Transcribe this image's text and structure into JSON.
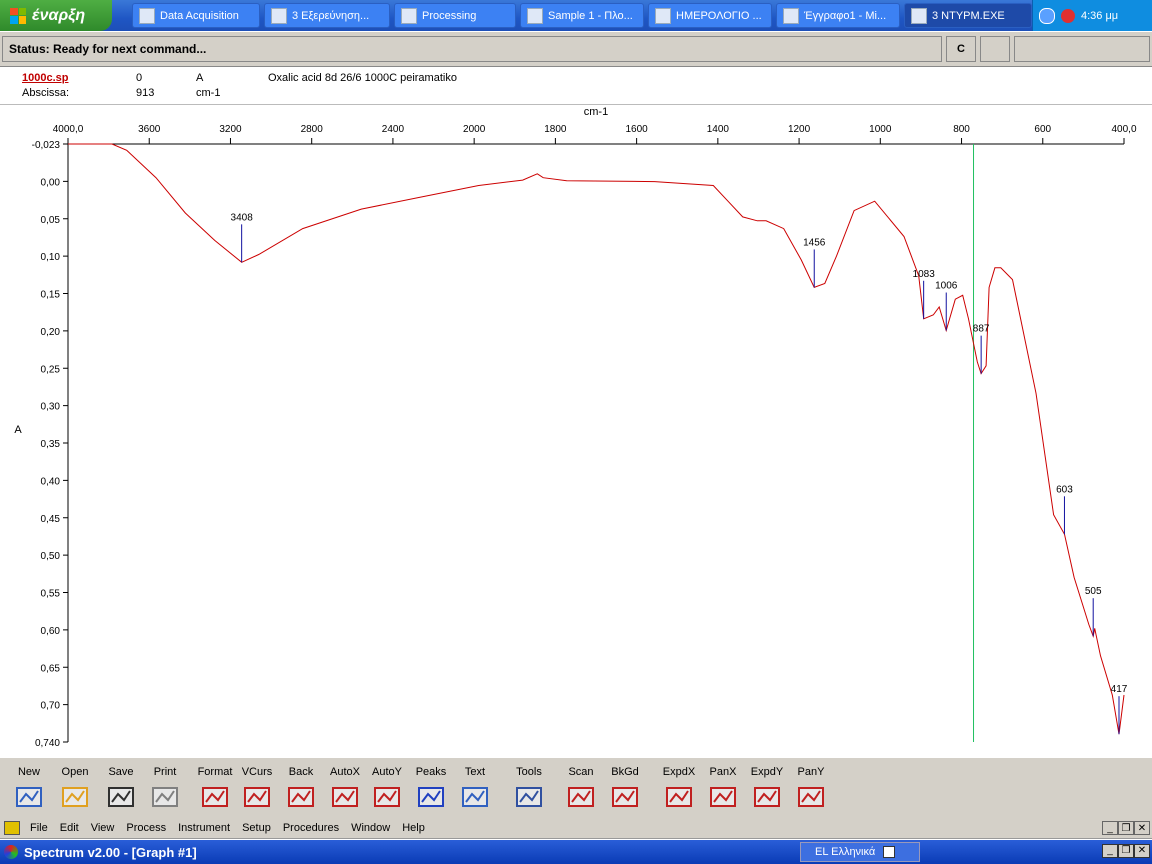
{
  "taskbar": {
    "start_label": "έναρξη",
    "tasks": [
      {
        "label": "Data Acquisition",
        "left": 132,
        "width": 128
      },
      {
        "label": "3 Εξερεύνηση...",
        "left": 264,
        "width": 126
      },
      {
        "label": "Processing",
        "left": 394,
        "width": 122
      },
      {
        "label": "Sample 1 - Πλο...",
        "left": 520,
        "width": 124
      },
      {
        "label": "ΗΜΕΡΟΛΟΓΙΟ ...",
        "left": 648,
        "width": 124
      },
      {
        "label": "Έγγραφο1 - Mi...",
        "left": 776,
        "width": 124
      },
      {
        "label": "3 ΝΤΥΡΜ.EXE",
        "left": 904,
        "width": 128
      }
    ],
    "clock": "4:36 μμ"
  },
  "status": {
    "text": "Status: Ready for next command...",
    "c_label": "C"
  },
  "info": {
    "file": "1000c.sp",
    "cursor_value": "0",
    "cursor_unit": "A",
    "description": "Oxalic acid 8d 26/6 1000C peiramatiko",
    "abscissa_label": "Abscissa:",
    "abscissa_value": "913",
    "abscissa_unit": "cm-1"
  },
  "chart_data": {
    "type": "line",
    "xlabel": "cm-1",
    "ylabel": "A",
    "xlim": [
      4000.0,
      400.0
    ],
    "ylim": [
      -0.023,
      0.74
    ],
    "x_ticks": [
      "4000,0",
      "3600",
      "3200",
      "2800",
      "2400",
      "2000",
      "1800",
      "1600",
      "1400",
      "1200",
      "1000",
      "800",
      "600",
      "400,0"
    ],
    "y_ticks": [
      "-0,023",
      "0,00",
      "0,05",
      "0,10",
      "0,15",
      "0,20",
      "0,25",
      "0,30",
      "0,35",
      "0,40",
      "0,45",
      "0,50",
      "0,55",
      "0,60",
      "0,65",
      "0,70",
      "0,740"
    ],
    "series": [
      {
        "color": "#cc0000",
        "x": [
          4000,
          3850,
          3800,
          3700,
          3600,
          3500,
          3408,
          3350,
          3200,
          3000,
          2800,
          2600,
          2450,
          2400,
          2380,
          2300,
          2000,
          1800,
          1750,
          1700,
          1650,
          1620,
          1560,
          1500,
          1456,
          1420,
          1380,
          1320,
          1250,
          1150,
          1100,
          1083,
          1050,
          1030,
          1006,
          975,
          950,
          930,
          900,
          887,
          870,
          860,
          840,
          820,
          780,
          700,
          640,
          603,
          570,
          520,
          505,
          500,
          480,
          440,
          417,
          400
        ],
        "y": [
          -0.023,
          -0.023,
          -0.015,
          0.02,
          0.065,
          0.1,
          0.128,
          0.118,
          0.085,
          0.06,
          0.045,
          0.03,
          0.023,
          0.015,
          0.02,
          0.024,
          0.025,
          0.03,
          0.05,
          0.07,
          0.075,
          0.075,
          0.085,
          0.125,
          0.16,
          0.155,
          0.12,
          0.062,
          0.05,
          0.095,
          0.145,
          0.2,
          0.195,
          0.185,
          0.215,
          0.175,
          0.17,
          0.2,
          0.255,
          0.27,
          0.26,
          0.16,
          0.135,
          0.135,
          0.15,
          0.295,
          0.45,
          0.475,
          0.53,
          0.59,
          0.605,
          0.595,
          0.63,
          0.68,
          0.73,
          0.68
        ]
      }
    ],
    "peaks": [
      {
        "label": "3408",
        "x": 3408,
        "y": 0.128
      },
      {
        "label": "1456",
        "x": 1456,
        "y": 0.16
      },
      {
        "label": "1083",
        "x": 1083,
        "y": 0.2
      },
      {
        "label": "1006",
        "x": 1006,
        "y": 0.215
      },
      {
        "label": "887",
        "x": 887,
        "y": 0.27
      },
      {
        "label": "603",
        "x": 603,
        "y": 0.475
      },
      {
        "label": "505",
        "x": 505,
        "y": 0.605
      },
      {
        "label": "417",
        "x": 417,
        "y": 0.73
      }
    ],
    "cursor_x": 913,
    "grid": false
  },
  "toolbar": {
    "buttons": [
      {
        "label": "New",
        "name": "new-button",
        "color": "#3060c0"
      },
      {
        "label": "Open",
        "name": "open-button",
        "color": "#e0a020"
      },
      {
        "label": "Save",
        "name": "save-button",
        "color": "#303030"
      },
      {
        "label": "Print",
        "name": "print-button",
        "color": "#808080"
      },
      {
        "label": "Format",
        "name": "format-button",
        "color": "#c02020"
      },
      {
        "label": "VCurs",
        "name": "vcurs-button",
        "color": "#c02020"
      },
      {
        "label": "Back",
        "name": "back-button",
        "color": "#c02020"
      },
      {
        "label": "AutoX",
        "name": "autox-button",
        "color": "#c02020"
      },
      {
        "label": "AutoY",
        "name": "autoy-button",
        "color": "#c02020"
      },
      {
        "label": "Peaks",
        "name": "peaks-button",
        "color": "#2040c0"
      },
      {
        "label": "Text",
        "name": "text-button",
        "color": "#3060c0"
      },
      {
        "label": "Tools",
        "name": "tools-button",
        "color": "#3050a0"
      },
      {
        "label": "Scan",
        "name": "scan-button",
        "color": "#c02020"
      },
      {
        "label": "BkGd",
        "name": "bkgd-button",
        "color": "#c02020"
      },
      {
        "label": "ExpdX",
        "name": "expdx-button",
        "color": "#c02020"
      },
      {
        "label": "PanX",
        "name": "panx-button",
        "color": "#c02020"
      },
      {
        "label": "ExpdY",
        "name": "expdy-button",
        "color": "#c02020"
      },
      {
        "label": "PanY",
        "name": "pany-button",
        "color": "#c02020"
      }
    ]
  },
  "menu": {
    "items": [
      "File",
      "Edit",
      "View",
      "Process",
      "Instrument",
      "Setup",
      "Procedures",
      "Window",
      "Help"
    ]
  },
  "window": {
    "title": "Spectrum v2.00 - [Graph #1]",
    "language": "EL Ελληνικά"
  }
}
